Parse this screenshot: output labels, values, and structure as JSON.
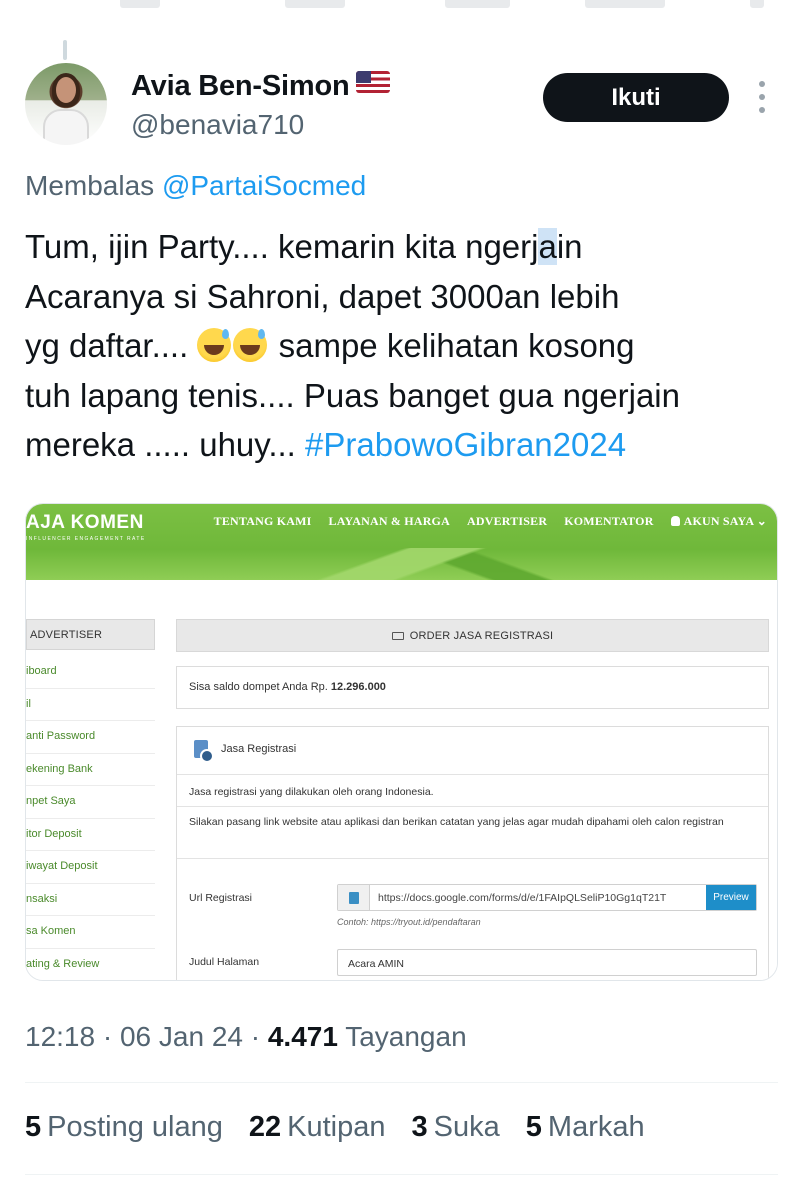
{
  "author": {
    "display_name": "Avia Ben-Simon",
    "handle": "@benavia710"
  },
  "follow_button": "Ikuti",
  "reply_context": {
    "prefix": "Membalas",
    "mention": "@PartaiSocmed"
  },
  "tweet": {
    "line1_a": "Tum, ijin Party.... kemarin kita ngerj",
    "line1_hl": "a",
    "line1_b": "in",
    "line2": "Acaranya si Sahroni, dapet 3000an lebih",
    "line3_a": "yg daftar....",
    "line3_b": "sampe kelihatan kosong",
    "line4": "tuh lapang tenis.... Puas banget gua ngerjain",
    "line5": "mereka ..... uhuy...",
    "hashtag": "#PrabowoGibran2024"
  },
  "embedded": {
    "logo": "AJA KOMEN",
    "logo_tagline": "INFLUENCER ENGAGEMENT RATE",
    "nav": [
      "TENTANG KAMI",
      "LAYANAN & HARGA",
      "ADVERTISER",
      "KOMENTATOR",
      "AKUN SAYA"
    ],
    "sidebar_title": "ADVERTISER",
    "sidebar_items": [
      "iboard",
      "il",
      "anti Password",
      "ekening Bank",
      "npet Saya",
      "itor Deposit",
      "iwayat Deposit",
      "nsaksi",
      "sa Komen",
      "ating & Review"
    ],
    "main_title": "ORDER JASA REGISTRASI",
    "saldo_label": "Sisa saldo dompet Anda Rp.",
    "saldo_value": "12.296.000",
    "panel_title": "Jasa Registrasi",
    "desc1": "Jasa registrasi yang dilakukan oleh orang Indonesia.",
    "desc2": "Silakan pasang link website atau aplikasi dan berikan catatan yang jelas agar mudah dipahami oleh calon registran",
    "url_label": "Url Registrasi",
    "url_value": "https://docs.google.com/forms/d/e/1FAIpQLSeliP10Gg1qT21T",
    "preview": "Preview",
    "url_hint": "Contoh: https://tryout.id/pendaftaran",
    "judul_label": "Judul Halaman",
    "judul_value": "Acara AMIN"
  },
  "meta": {
    "time": "12:18",
    "date": "06 Jan 24",
    "views_count": "4.471",
    "views_label": "Tayangan",
    "sep": "·"
  },
  "stats": [
    {
      "count": "5",
      "label": "Posting ulang"
    },
    {
      "count": "22",
      "label": "Kutipan"
    },
    {
      "count": "3",
      "label": "Suka"
    },
    {
      "count": "5",
      "label": "Markah"
    }
  ]
}
